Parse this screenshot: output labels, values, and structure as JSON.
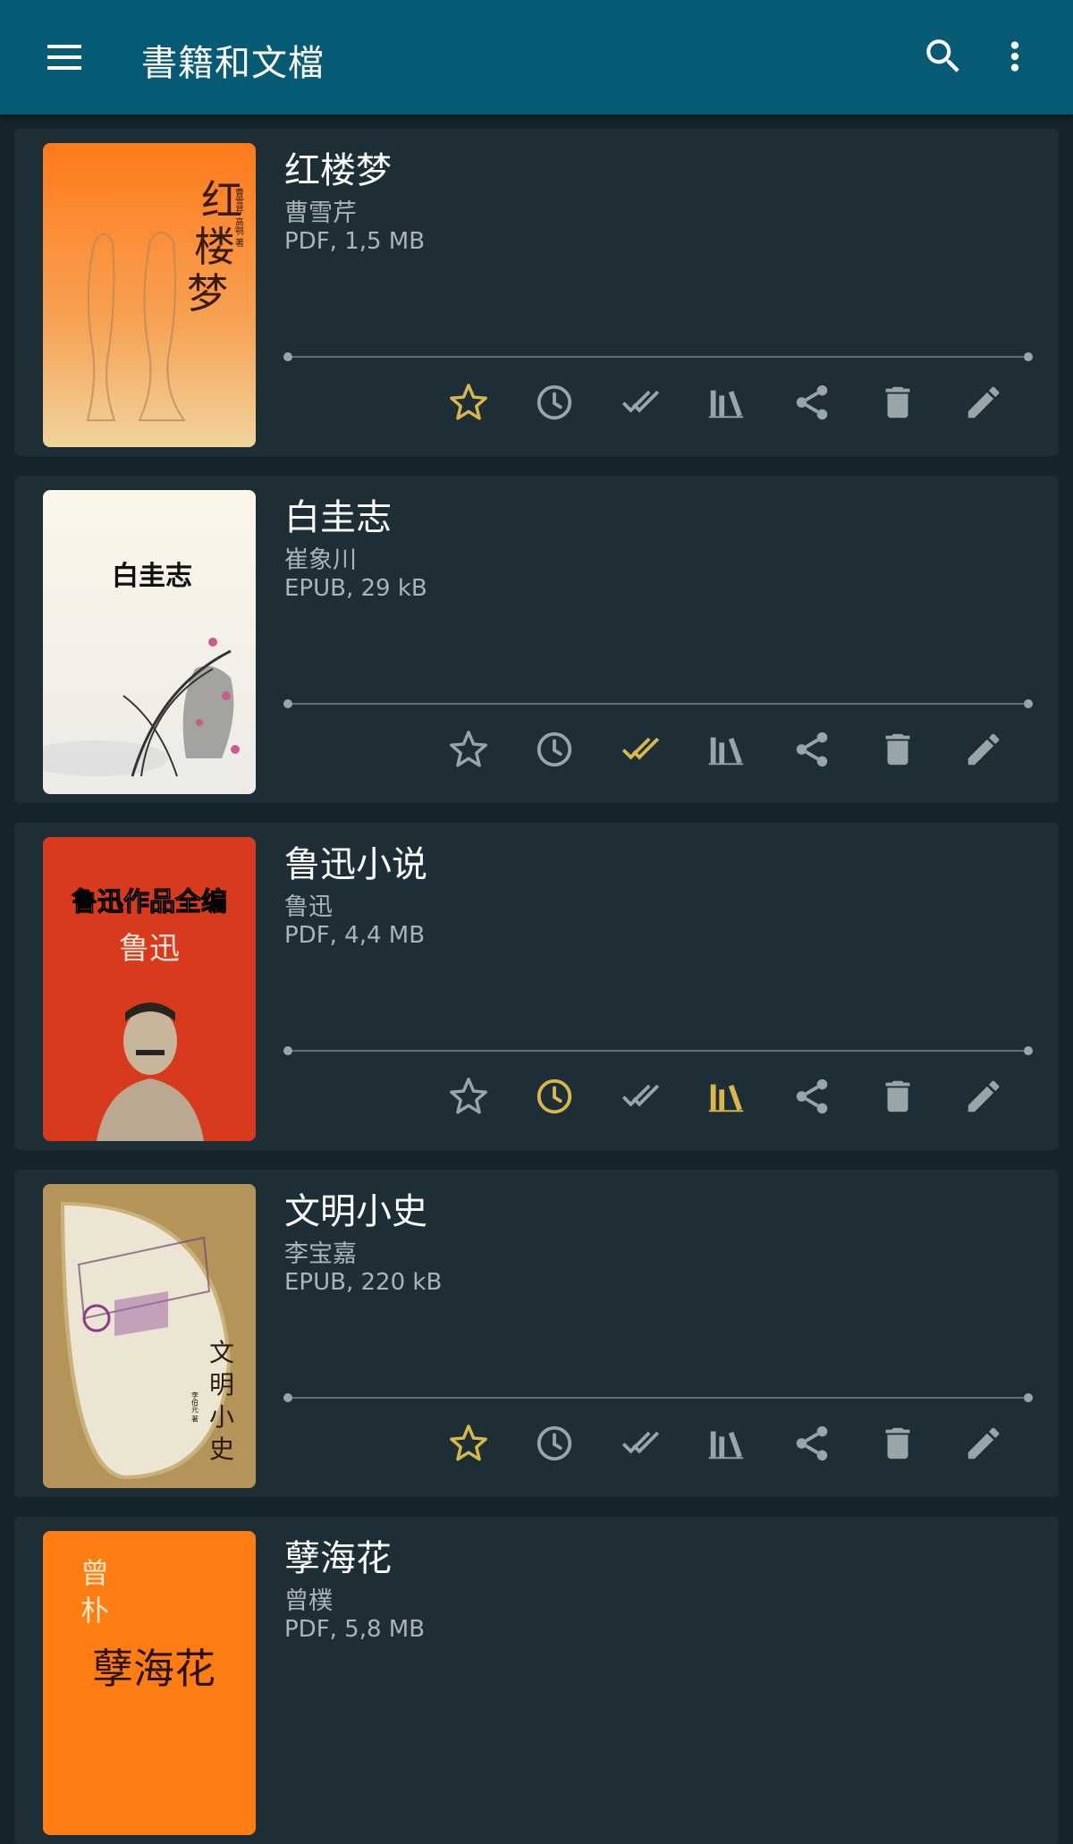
{
  "app_bar": {
    "title": "書籍和文檔",
    "menu_icon": "menu-icon",
    "search_icon": "search-icon",
    "more_icon": "more-vert-icon",
    "background": "#065a73"
  },
  "colors": {
    "active_icon": "#d9b84a",
    "inactive_icon": "#9aa5aa",
    "card": "#1d2e36",
    "background": "#13242c"
  },
  "books": [
    {
      "title": "红楼梦",
      "author": "曹雪芹",
      "meta": "PDF, 1,5 MB",
      "cover_text": [
        "红",
        "楼",
        "梦"
      ],
      "cover_small_text": "曹雪芹 高鹗 著",
      "favorite": true,
      "to_read": false,
      "finished": false,
      "on_shelf": false
    },
    {
      "title": "白圭志",
      "author": "崔象川",
      "meta": "EPUB, 29 kB",
      "cover_text": [
        "白圭志"
      ],
      "favorite": false,
      "to_read": false,
      "finished": true,
      "on_shelf": false
    },
    {
      "title": "鲁迅小说",
      "author": "鲁迅",
      "meta": "PDF, 4,4 MB",
      "cover_text": [
        "鲁迅作品全编",
        "鲁迅"
      ],
      "favorite": false,
      "to_read": true,
      "finished": false,
      "on_shelf": true
    },
    {
      "title": "文明小史",
      "author": "李宝嘉",
      "meta": "EPUB, 220 kB",
      "cover_text": [
        "文",
        "明",
        "小",
        "史"
      ],
      "cover_small_text": "李伯元 著",
      "favorite": true,
      "to_read": false,
      "finished": false,
      "on_shelf": false
    },
    {
      "title": "孽海花",
      "author": "曾樸",
      "meta": "PDF, 5,8 MB",
      "cover_text": [
        "曾",
        "朴",
        "孽海花"
      ],
      "favorite": false,
      "to_read": false,
      "finished": false,
      "on_shelf": false
    }
  ],
  "action_icons": [
    "star-icon",
    "clock-icon",
    "done-all-icon",
    "library-icon",
    "share-icon",
    "delete-icon",
    "edit-icon"
  ]
}
